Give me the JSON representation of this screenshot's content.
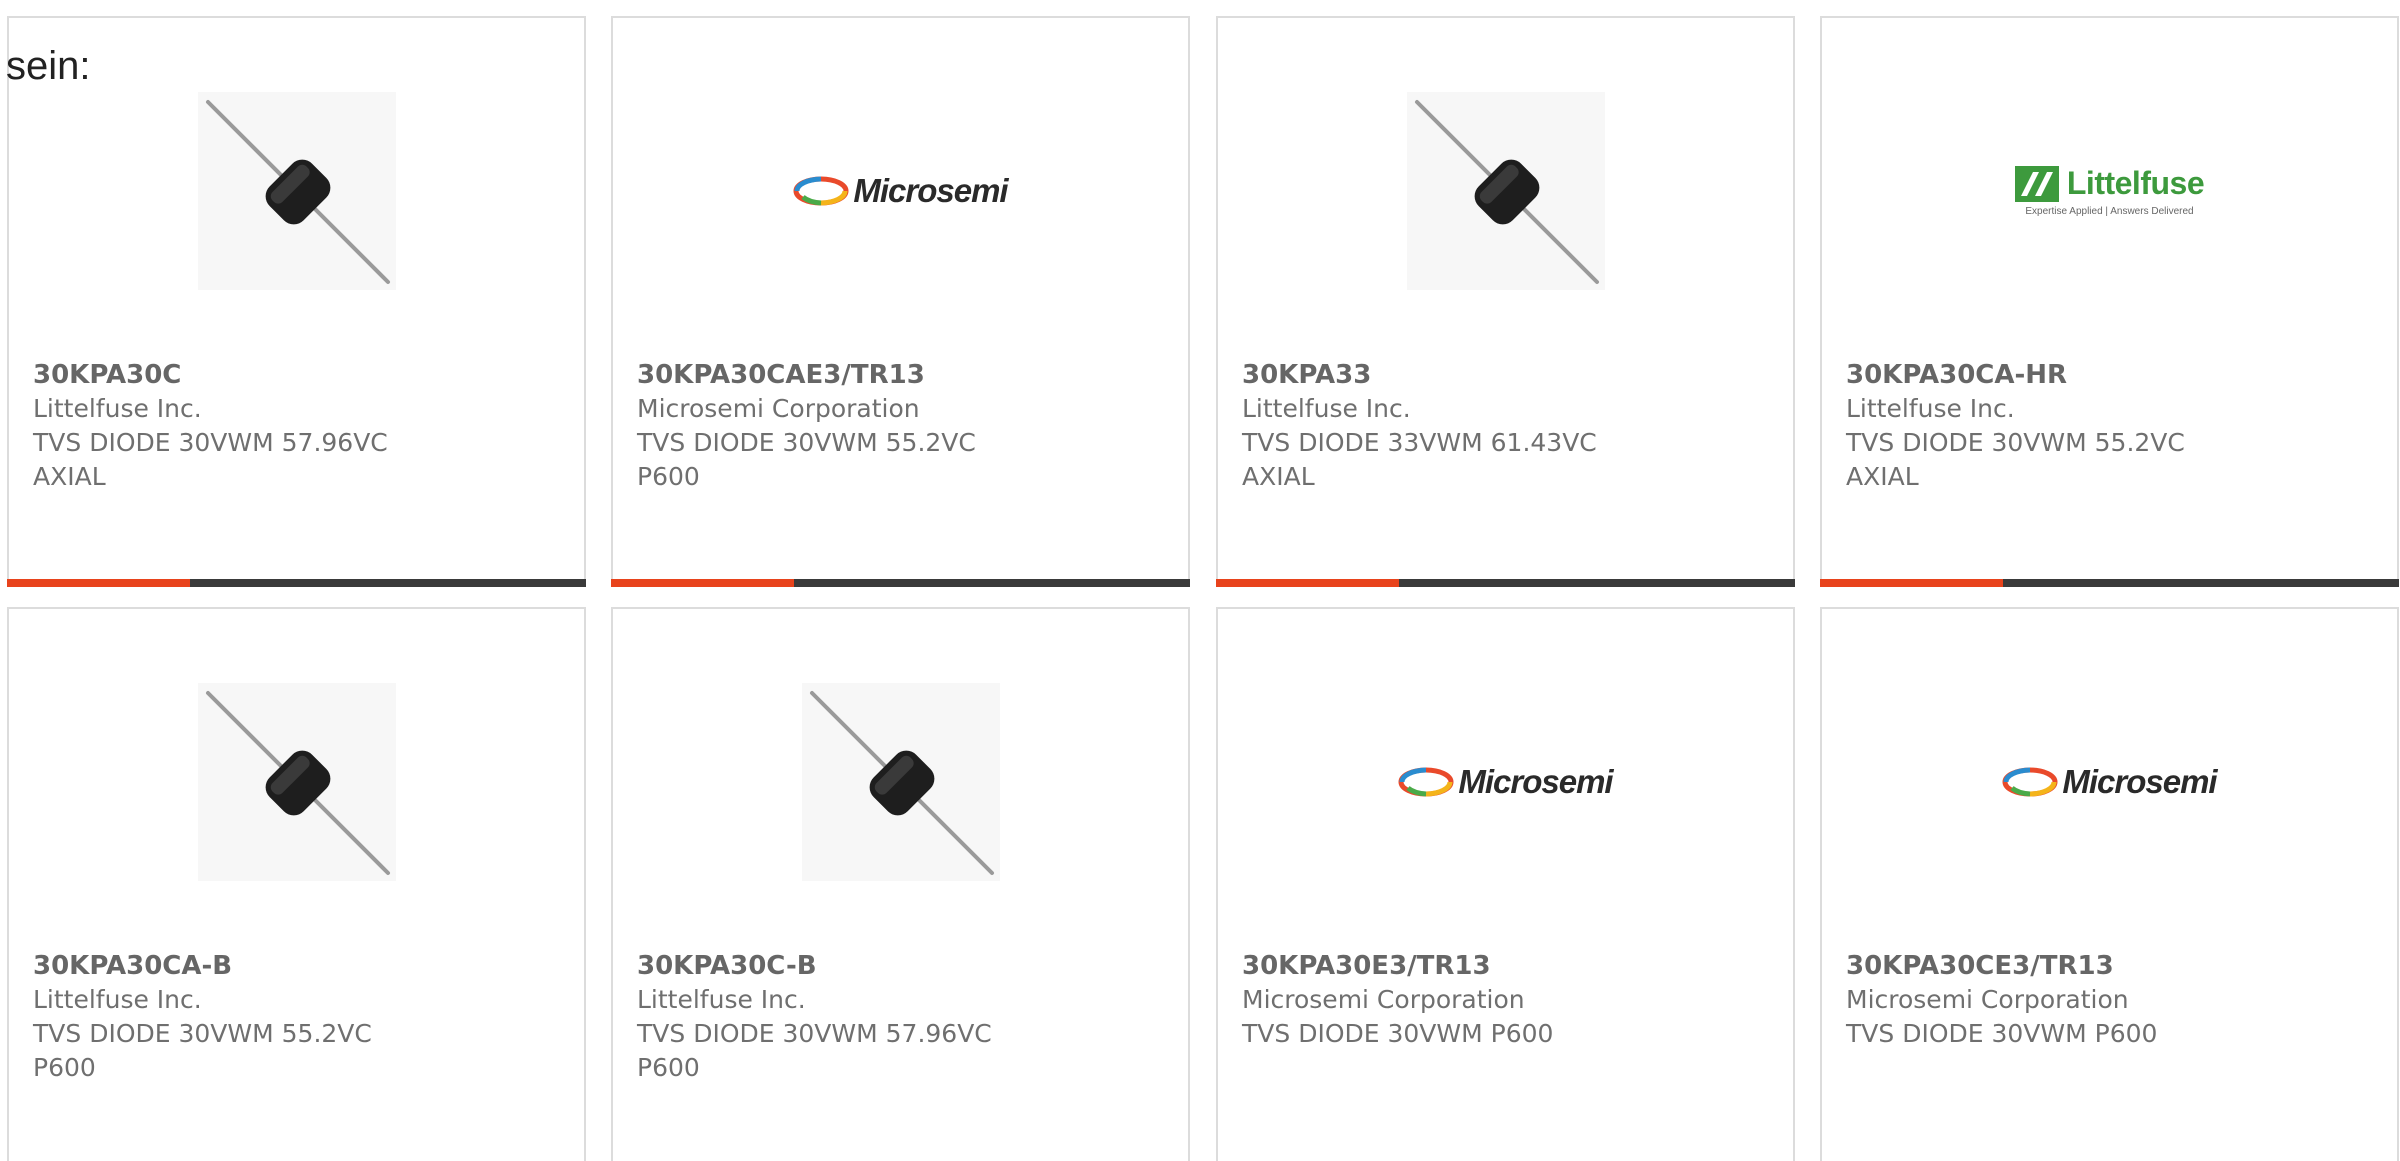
{
  "intro_text": "sein:",
  "colors": {
    "accent": "#e8431c",
    "bar": "#3a3a3a",
    "card_border": "#dcdcdc",
    "text": "#6f6f6f",
    "littelfuse_green": "#3d9a3d"
  },
  "logos": {
    "microsemi": "Microsemi",
    "littelfuse": "Littelfuse",
    "littelfuse_tagline": "Expertise Applied | Answers Delivered"
  },
  "products": [
    {
      "part": "30KPA30C",
      "manufacturer": "Littelfuse Inc.",
      "description": "TVS DIODE 30VWM 57.96VC AXIAL",
      "image": "diode-image"
    },
    {
      "part": "30KPA30CAE3/TR13",
      "manufacturer": "Microsemi Corporation",
      "description": "TVS DIODE 30VWM 55.2VC P600",
      "image": "microsemi-logo"
    },
    {
      "part": "30KPA33",
      "manufacturer": "Littelfuse Inc.",
      "description": "TVS DIODE 33VWM 61.43VC AXIAL",
      "image": "diode-image"
    },
    {
      "part": "30KPA30CA-HR",
      "manufacturer": "Littelfuse Inc.",
      "description": "TVS DIODE 30VWM 55.2VC AXIAL",
      "image": "littelfuse-logo"
    },
    {
      "part": "30KPA30CA-B",
      "manufacturer": "Littelfuse Inc.",
      "description": "TVS DIODE 30VWM 55.2VC P600",
      "image": "diode-image"
    },
    {
      "part": "30KPA30C-B",
      "manufacturer": "Littelfuse Inc.",
      "description": "TVS DIODE 30VWM 57.96VC P600",
      "image": "diode-image"
    },
    {
      "part": "30KPA30E3/TR13",
      "manufacturer": "Microsemi Corporation",
      "description": "TVS DIODE 30VWM P600",
      "image": "microsemi-logo"
    },
    {
      "part": "30KPA30CE3/TR13",
      "manufacturer": "Microsemi Corporation",
      "description": "TVS DIODE 30VWM P600",
      "image": "microsemi-logo"
    }
  ]
}
